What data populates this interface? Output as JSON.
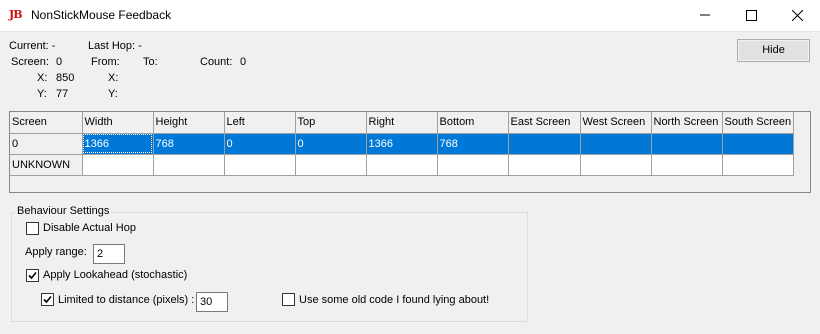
{
  "window": {
    "title": "NonStickMouse Feedback",
    "app_icon_text": "JB"
  },
  "info": {
    "current_label": "Current: -",
    "screen_label": "Screen:",
    "screen_value": "0",
    "x_label": "X:",
    "x_value": "850",
    "y_label": "Y:",
    "y_value": "77",
    "last_hop_label": "Last Hop: -",
    "from_label": "From:",
    "to_label": "To:",
    "hop_x_label": "X:",
    "hop_y_label": "Y:",
    "count_label": "Count:",
    "count_value": "0"
  },
  "buttons": {
    "hide": "Hide"
  },
  "grid": {
    "headers": [
      "Screen",
      "Width",
      "Height",
      "Left",
      "Top",
      "Right",
      "Bottom",
      "East Screen",
      "West Screen",
      "North Screen",
      "South Screen"
    ],
    "rows": [
      [
        "0",
        "1366",
        "768",
        "0",
        "0",
        "1366",
        "768",
        "",
        "",
        "",
        ""
      ],
      [
        "UNKNOWN",
        "",
        "",
        "",
        "",
        "",
        "",
        "",
        "",
        "",
        ""
      ]
    ],
    "selected_row": 0
  },
  "behaviour": {
    "group_title": "Behaviour Settings",
    "disable_actual_hop": {
      "label": "Disable Actual Hop",
      "checked": false
    },
    "apply_range_label": "Apply range:",
    "apply_range_value": "2",
    "apply_lookahead": {
      "label": "Apply Lookahead (stochastic)",
      "checked": true
    },
    "limited_to_distance": {
      "label": "Limited to distance (pixels) :",
      "checked": true
    },
    "distance_value": "30",
    "old_code": {
      "label": "Use some old code I found lying about!",
      "checked": false
    }
  },
  "colors": {
    "selection": "#0078d7",
    "app_icon": "#d01010"
  }
}
